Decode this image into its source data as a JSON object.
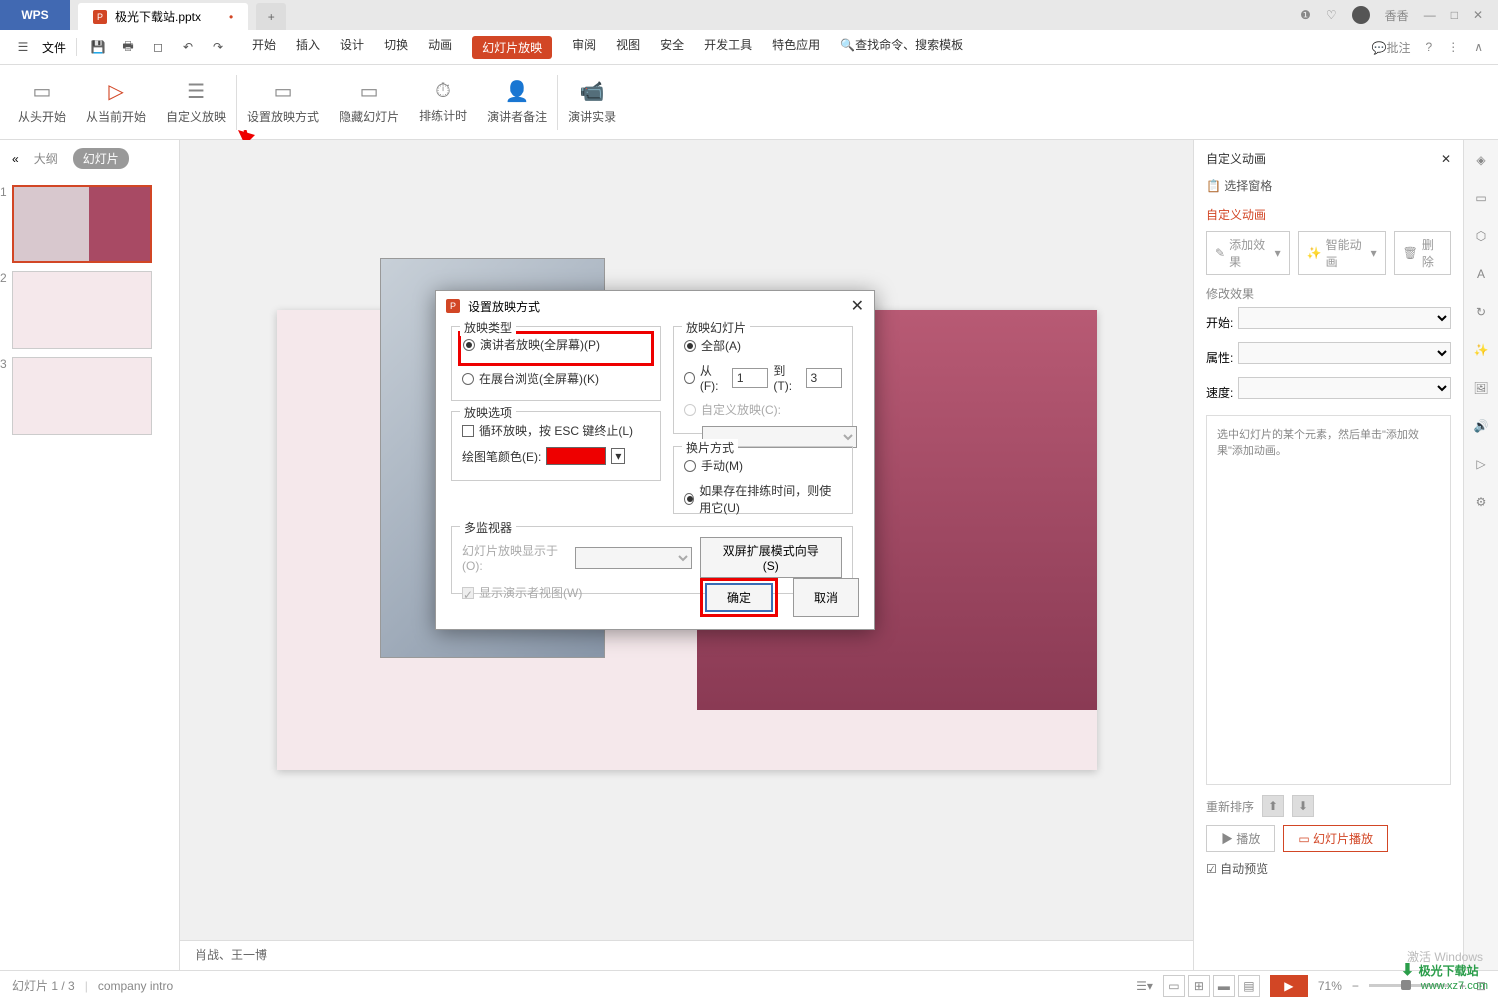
{
  "titlebar": {
    "wps": "WPS",
    "filename": "极光下载站.pptx",
    "user": "香香"
  },
  "menu": {
    "file": "文件",
    "start": "开始",
    "insert": "插入",
    "design": "设计",
    "trans": "切换",
    "anim": "动画",
    "show": "幻灯片放映",
    "review": "审阅",
    "view": "视图",
    "security": "安全",
    "dev": "开发工具",
    "feature": "特色应用",
    "search": "查找命令、搜索模板",
    "comment": "批注"
  },
  "ribbon": {
    "r1": "从头开始",
    "r2": "从当前开始",
    "r3": "自定义放映",
    "r4": "设置放映方式",
    "r5": "隐藏幻灯片",
    "r6": "排练计时",
    "r7": "演讲者备注",
    "r8": "演讲实录"
  },
  "side": {
    "outline": "大纲",
    "slides": "幻灯片"
  },
  "notes": "肖战、王一博",
  "anim": {
    "title": "自定义动画",
    "pane": "选择窗格",
    "custom": "自定义动画",
    "addfx": "添加效果",
    "smart": "智能动画",
    "delete": "删除",
    "modify": "修改效果",
    "start": "开始:",
    "attr": "属性:",
    "speed": "速度:",
    "hint": "选中幻灯片的某个元素，然后单击\"添加效果\"添加动画。",
    "reorder": "重新排序",
    "play": "播放",
    "show": "幻灯片播放",
    "autopreview": "自动预览"
  },
  "dialog": {
    "title": "设置放映方式",
    "type_label": "放映类型",
    "type1": "演讲者放映(全屏幕)(P)",
    "type2": "在展台浏览(全屏幕)(K)",
    "slides_label": "放映幻灯片",
    "all": "全部(A)",
    "from": "从(F):",
    "to": "到(T):",
    "from_val": "1",
    "to_val": "3",
    "custom": "自定义放映(C):",
    "options_label": "放映选项",
    "loop": "循环放映，按 ESC 键终止(L)",
    "pencolor": "绘图笔颜色(E):",
    "advance_label": "换片方式",
    "manual": "手动(M)",
    "timing": "如果存在排练时间，则使用它(U)",
    "monitor_label": "多监视器",
    "displayon": "幻灯片放映显示于(O):",
    "dualbtn": "双屏扩展模式向导(S)",
    "showview": "显示演示者视图(W)",
    "ok": "确定",
    "cancel": "取消"
  },
  "status": {
    "page": "幻灯片 1 / 3",
    "intro": "company intro",
    "zoom": "71%"
  },
  "watermark": {
    "w1": "激活 Windows",
    "w2": "极光下载站",
    "w3": "www.xz7.com"
  }
}
